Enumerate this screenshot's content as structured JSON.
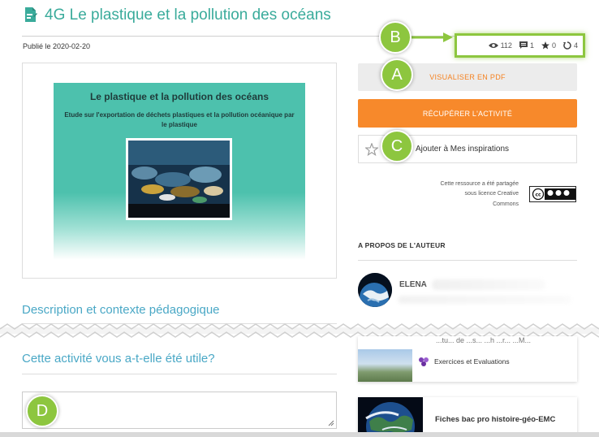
{
  "page": {
    "title": "4G Le plastique et la pollution des océans",
    "published": "Publié le 2020-02-20"
  },
  "stats": {
    "views": "112",
    "comments": "1",
    "favorites": "0",
    "reuses": "4"
  },
  "preview": {
    "title": "Le plastique et la pollution des océans",
    "subtitle": "Etude sur l'exportation de déchets plastiques et la pollution océanique par le plastique"
  },
  "actions": {
    "pdf_label": "VISUALISER EN PDF",
    "get_label": "RÉCUPÉRER L'ACTIVITÉ",
    "inspiration_label": "Ajouter à Mes inspirations"
  },
  "license": {
    "line1": "Cette ressource a été partagée",
    "line2": "sous licence Creative",
    "line3": "Commons"
  },
  "author": {
    "section_title": "A PROPOS DE L'AUTEUR",
    "name": "ELENA"
  },
  "sections": {
    "description": "Description et contexte pédagogique",
    "useful": "Cette activité vous a-t-elle été utile?"
  },
  "cards": {
    "top_cut_text": "...tu... de ...s... ...h ...r...  ...M...",
    "top_category": "Exercices et Evaluations",
    "bottom_label": "Fiches bac pro histoire-géo-EMC"
  },
  "markers": {
    "a": "A",
    "b": "B",
    "c": "C",
    "d": "D"
  },
  "colors": {
    "accent_teal": "#3aab9b",
    "heading_blue": "#4aa8c6",
    "orange": "#f7892b",
    "marker_green": "#8dc63f"
  }
}
